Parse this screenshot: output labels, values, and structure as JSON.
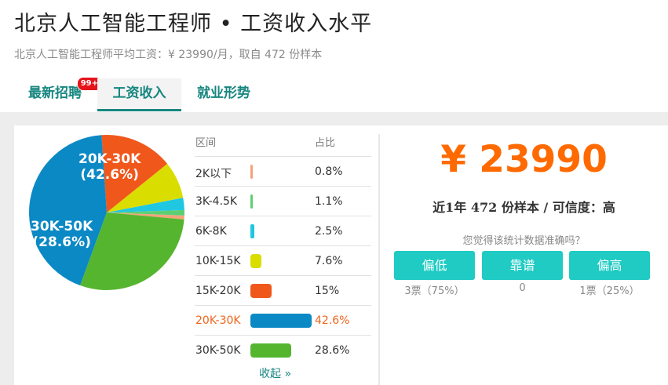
{
  "header": {
    "title": "北京人工智能工程师 • 工资收入水平",
    "subtitle": "北京人工智能工程师平均工资：¥ 23990/月，取自 472 份样本"
  },
  "tabs": [
    {
      "label": "最新招聘",
      "badge": "99+"
    },
    {
      "label": "工资收入"
    },
    {
      "label": "就业形势"
    }
  ],
  "chart_data": {
    "type": "pie",
    "categories": [
      "2K以下",
      "3K-4.5K",
      "6K-8K",
      "10K-15K",
      "15K-20K",
      "20K-30K",
      "30K-50K"
    ],
    "values": [
      0.8,
      1.1,
      2.5,
      7.6,
      15,
      42.6,
      28.6
    ],
    "colors": [
      "#f4a37a",
      "#5ccf73",
      "#20c7e1",
      "#d9dd00",
      "#f0571b",
      "#0b89c5",
      "#55b52f"
    ],
    "labels": [
      {
        "range": "20K-30K",
        "pct": "(42.6%)"
      },
      {
        "range": "30K-50K",
        "pct": "(28.6%)"
      }
    ]
  },
  "table": {
    "col_range": "区间",
    "col_pct": "占比",
    "rows": [
      {
        "range": "2K以下",
        "pct": "0.8%"
      },
      {
        "range": "3K-4.5K",
        "pct": "1.1%"
      },
      {
        "range": "6K-8K",
        "pct": "2.5%"
      },
      {
        "range": "10K-15K",
        "pct": "7.6%"
      },
      {
        "range": "15K-20K",
        "pct": "15%"
      },
      {
        "range": "20K-30K",
        "pct": "42.6%"
      },
      {
        "range": "30K-50K",
        "pct": "28.6%"
      }
    ],
    "highlight_index": 5,
    "collapse": "收起 »"
  },
  "summary": {
    "average": "¥ 23990",
    "sample": "近1年 472 份样本 / 可信度：高",
    "question": "您觉得该统计数据准确吗？"
  },
  "votes": [
    {
      "label": "偏低",
      "count": "3票（75%）"
    },
    {
      "label": "靠谱",
      "count": "0"
    },
    {
      "label": "偏高",
      "count": "1票（25%）"
    }
  ]
}
